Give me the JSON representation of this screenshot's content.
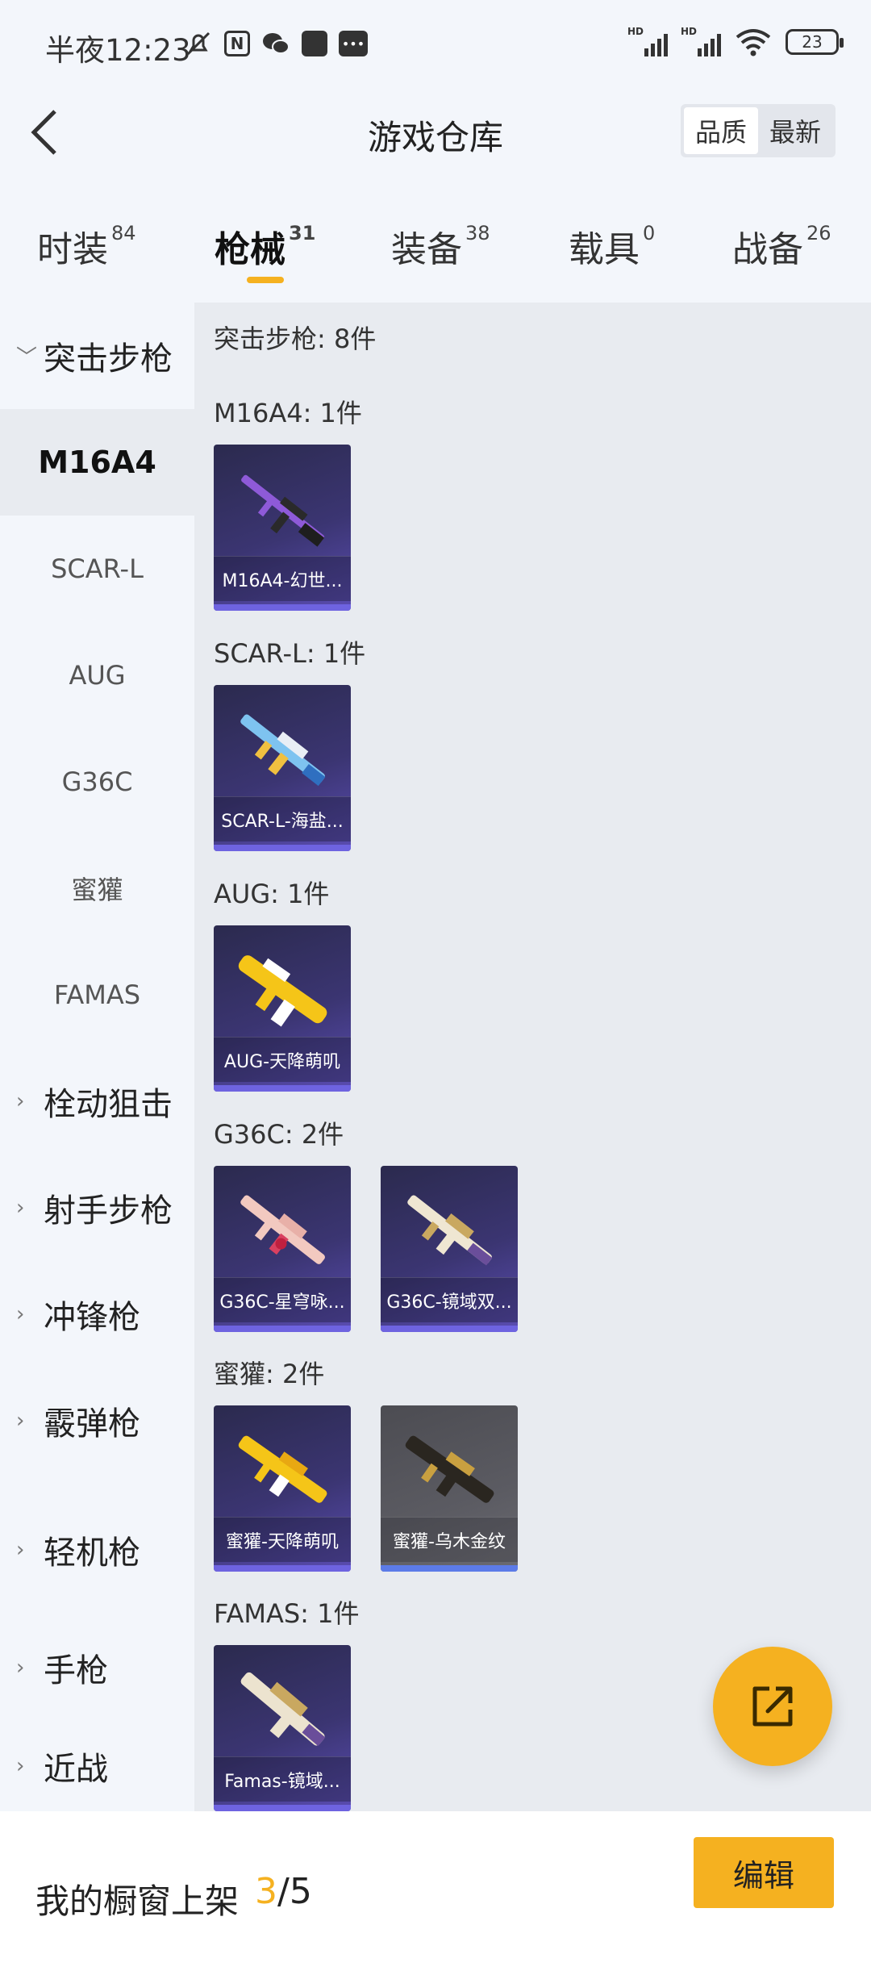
{
  "status_bar": {
    "time": "半夜12:23",
    "battery": "23",
    "signal_label": "HD"
  },
  "header": {
    "title": "游戏仓库",
    "sort_options": [
      "品质",
      "最新"
    ],
    "sort_selected": "品质"
  },
  "tabs": [
    {
      "label": "时装",
      "count": "84"
    },
    {
      "label": "枪械",
      "count": "31"
    },
    {
      "label": "装备",
      "count": "38"
    },
    {
      "label": "载具",
      "count": "0"
    },
    {
      "label": "战备",
      "count": "26"
    }
  ],
  "active_tab": "枪械",
  "sidebar": {
    "groups": [
      {
        "label": "突击步枪",
        "expanded": true
      },
      {
        "label": "栓动狙击"
      },
      {
        "label": "射手步枪"
      },
      {
        "label": "冲锋枪"
      },
      {
        "label": "霰弹枪"
      },
      {
        "label": "轻机枪"
      },
      {
        "label": "手枪"
      },
      {
        "label": "近战"
      }
    ],
    "subitems": [
      "M16A4",
      "SCAR-L",
      "AUG",
      "G36C",
      "蜜獾",
      "FAMAS"
    ],
    "selected_subitem": "M16A4"
  },
  "content": {
    "category_title": "突击步枪: 8件",
    "sections": [
      {
        "title": "M16A4: 1件",
        "items": [
          {
            "name": "M16A4-幻世...",
            "tint": "purple"
          }
        ]
      },
      {
        "title": "SCAR-L: 1件",
        "items": [
          {
            "name": "SCAR-L-海盐...",
            "tint": "purple"
          }
        ]
      },
      {
        "title": "AUG: 1件",
        "items": [
          {
            "name": "AUG-天降萌叽",
            "tint": "purple"
          }
        ]
      },
      {
        "title": "G36C: 2件",
        "items": [
          {
            "name": "G36C-星穹咏...",
            "tint": "purple"
          },
          {
            "name": "G36C-镜域双...",
            "tint": "purple"
          }
        ]
      },
      {
        "title": "蜜獾: 2件",
        "items": [
          {
            "name": "蜜獾-天降萌叽",
            "tint": "purple"
          },
          {
            "name": "蜜獾-乌木金纹",
            "tint": "gray"
          }
        ]
      },
      {
        "title": "FAMAS: 1件",
        "items": [
          {
            "name": "Famas-镜域...",
            "tint": "purple"
          }
        ]
      }
    ]
  },
  "bottom_bar": {
    "showcase_label": "我的橱窗上架",
    "showcase_current": "3",
    "showcase_total": "/5",
    "edit_label": "编辑"
  },
  "colors": {
    "accent": "#f5b120",
    "card_purple": "#3b3572",
    "card_gray": "#5b5b62"
  }
}
